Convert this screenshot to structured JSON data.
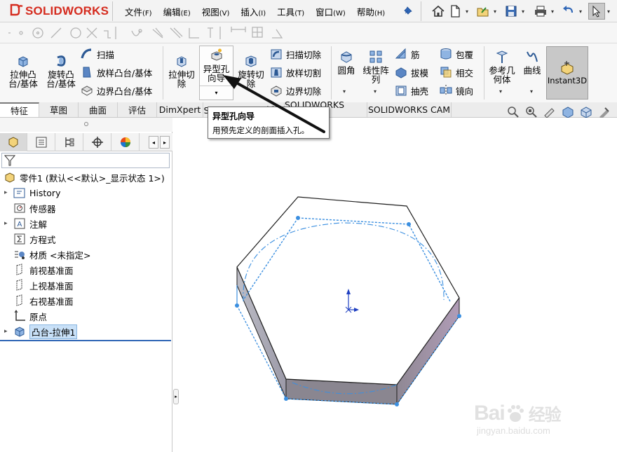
{
  "app": {
    "logo_text": "SOLIDWORKS",
    "brand_color": "#d52b1e",
    "accent_color": "#2f66b6"
  },
  "menu": [
    {
      "label": "文件",
      "key": "(F)"
    },
    {
      "label": "编辑",
      "key": "(E)"
    },
    {
      "label": "视图",
      "key": "(V)"
    },
    {
      "label": "插入",
      "key": "(I)"
    },
    {
      "label": "工具",
      "key": "(T)"
    },
    {
      "label": "窗口",
      "key": "(W)"
    },
    {
      "label": "帮助",
      "key": "(H)"
    }
  ],
  "quick_access": [
    "home-icon",
    "new-document-icon",
    "open-icon",
    "save-icon",
    "print-icon",
    "undo-icon",
    "select-icon"
  ],
  "commands": {
    "extrude_boss": "拉伸凸\n台/基体",
    "revolve_boss": "旋转凸\n台/基体",
    "sweep": "扫描",
    "loft_boss": "放样凸台/基体",
    "boundary_boss": "边界凸台/基体",
    "extrude_cut": "拉伸切\n除",
    "hole_wizard": "异型孔\n向导",
    "revolve_cut": "旋转切\n除",
    "sweep_cut": "扫描切除",
    "loft_cut": "放样切割",
    "boundary_cut": "边界切除",
    "fillet": "圆角",
    "linear_pattern": "线性阵\n列",
    "rib": "筋",
    "draft": "拔模",
    "shell": "抽壳",
    "wrap": "包覆",
    "intersect": "相交",
    "mirror": "镜向",
    "ref_geometry": "参考几\n何体",
    "curves": "曲线",
    "instant3d": "Instant3D"
  },
  "tabs": [
    "特征",
    "草图",
    "曲面",
    "评估",
    "DimXpert",
    "SOLIDWORKS 插件",
    "SOLIDWORKS MBD",
    "SOLIDWORKS CAM"
  ],
  "tooltip": {
    "title": "异型孔向导",
    "description": "用预先定义的剖面插入孔。"
  },
  "feature_tree": {
    "root": "零件1 (默认<<默认>_显示状态 1>)",
    "items": [
      {
        "label": "History",
        "icon": "history-icon",
        "expandable": true
      },
      {
        "label": "传感器",
        "icon": "sensor-icon",
        "expandable": false
      },
      {
        "label": "注解",
        "icon": "annotation-icon",
        "expandable": true
      },
      {
        "label": "方程式",
        "icon": "equation-icon",
        "expandable": false
      },
      {
        "label": "材质 <未指定>",
        "icon": "material-icon",
        "expandable": false
      },
      {
        "label": "前视基准面",
        "icon": "plane-icon",
        "expandable": false
      },
      {
        "label": "上视基准面",
        "icon": "plane-icon",
        "expandable": false
      },
      {
        "label": "右视基准面",
        "icon": "plane-icon",
        "expandable": false
      },
      {
        "label": "原点",
        "icon": "origin-icon",
        "expandable": false
      },
      {
        "label": "凸台-拉伸1",
        "icon": "extrude-feature-icon",
        "expandable": true,
        "selected": true
      }
    ]
  },
  "watermark": {
    "brand": "Bai",
    "brand_cn": "经验",
    "url": "jingyan.baidu.com"
  }
}
